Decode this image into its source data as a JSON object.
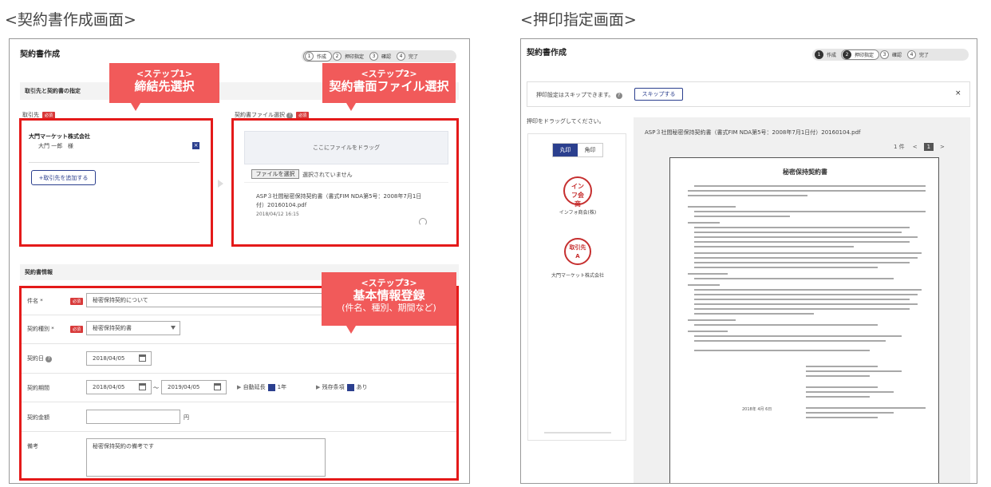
{
  "captions": {
    "left": "<契約書作成画面>",
    "right": "<押印指定画面>"
  },
  "left": {
    "title": "契約書作成",
    "steps": [
      {
        "num": "1",
        "label": "作成"
      },
      {
        "num": "2",
        "label": "押印指定"
      },
      {
        "num": "3",
        "label": "確認"
      },
      {
        "num": "4",
        "label": "完了"
      }
    ],
    "section1": "取引先と契約書の指定",
    "partner": {
      "label": "取引先",
      "required": "必須",
      "company": "大門マーケット株式会社",
      "person": "大門 一郎",
      "honorific": "様",
      "add_button": "+取引先を追加する"
    },
    "file": {
      "label": "契約書ファイル選択",
      "required": "必須",
      "drop": "ここにファイルをドラッグ",
      "choose_button": "ファイルを選択",
      "no_file": "選択されていません",
      "filename": "ASP３社間秘密保持契約書（書式FIM NDA第5号：2008年7月1日付）20160104.pdf",
      "date": "2018/04/12 16:15"
    },
    "section2": "契約書情報",
    "form": {
      "name_label": "件名 *",
      "name_value": "秘密保持契約について",
      "type_label": "契約種別 *",
      "type_value": "秘密保持契約書",
      "date_label": "契約日",
      "date_value": "2018/04/05",
      "period_label": "契約期間",
      "period_from": "2018/04/05",
      "period_sep": "〜",
      "period_to": "2019/04/05",
      "auto_renew": "自動延長",
      "renew_value": "1年",
      "survival": "残存条項",
      "survival_value": "あり",
      "amount_label": "契約金額",
      "amount_unit": "円",
      "note_label": "備考",
      "note_value": "秘密保持契約の備考です",
      "required": "必須"
    },
    "callouts": {
      "step1": {
        "title": "<ステップ1>",
        "main": "締結先選択"
      },
      "step2": {
        "title": "<ステップ2>",
        "main": "契約書面ファイル選択"
      },
      "step3": {
        "title": "<ステップ3>",
        "main": "基本情報登録",
        "sub": "(件名、種別、期間など)"
      }
    }
  },
  "right": {
    "title": "契約書作成",
    "steps": [
      {
        "num": "1",
        "label": "作成"
      },
      {
        "num": "2",
        "label": "押印指定"
      },
      {
        "num": "3",
        "label": "確認"
      },
      {
        "num": "4",
        "label": "完了"
      }
    ],
    "skip_text": "押印設定はスキップできます。",
    "skip_button": "スキップする",
    "drag_text": "押印をドラッグしてください。",
    "seal_tabs": [
      "丸印",
      "角印"
    ],
    "seal1_chars": "インフ会商",
    "seal1_label": "インフォ商会(株)",
    "seal2_chars": "取引先A",
    "seal2_label": "大門マーケット株式会社",
    "doc_filename": "ASP３社間秘密保持契約書（書式FIM NDA第5号：2008年7月1日付）20160104.pdf",
    "pager": {
      "count": "1 件",
      "prev": "<",
      "page": "1",
      "next": ">"
    },
    "doc_title": "秘密保持契約書",
    "doc_date": "2018年 4月 6日"
  }
}
